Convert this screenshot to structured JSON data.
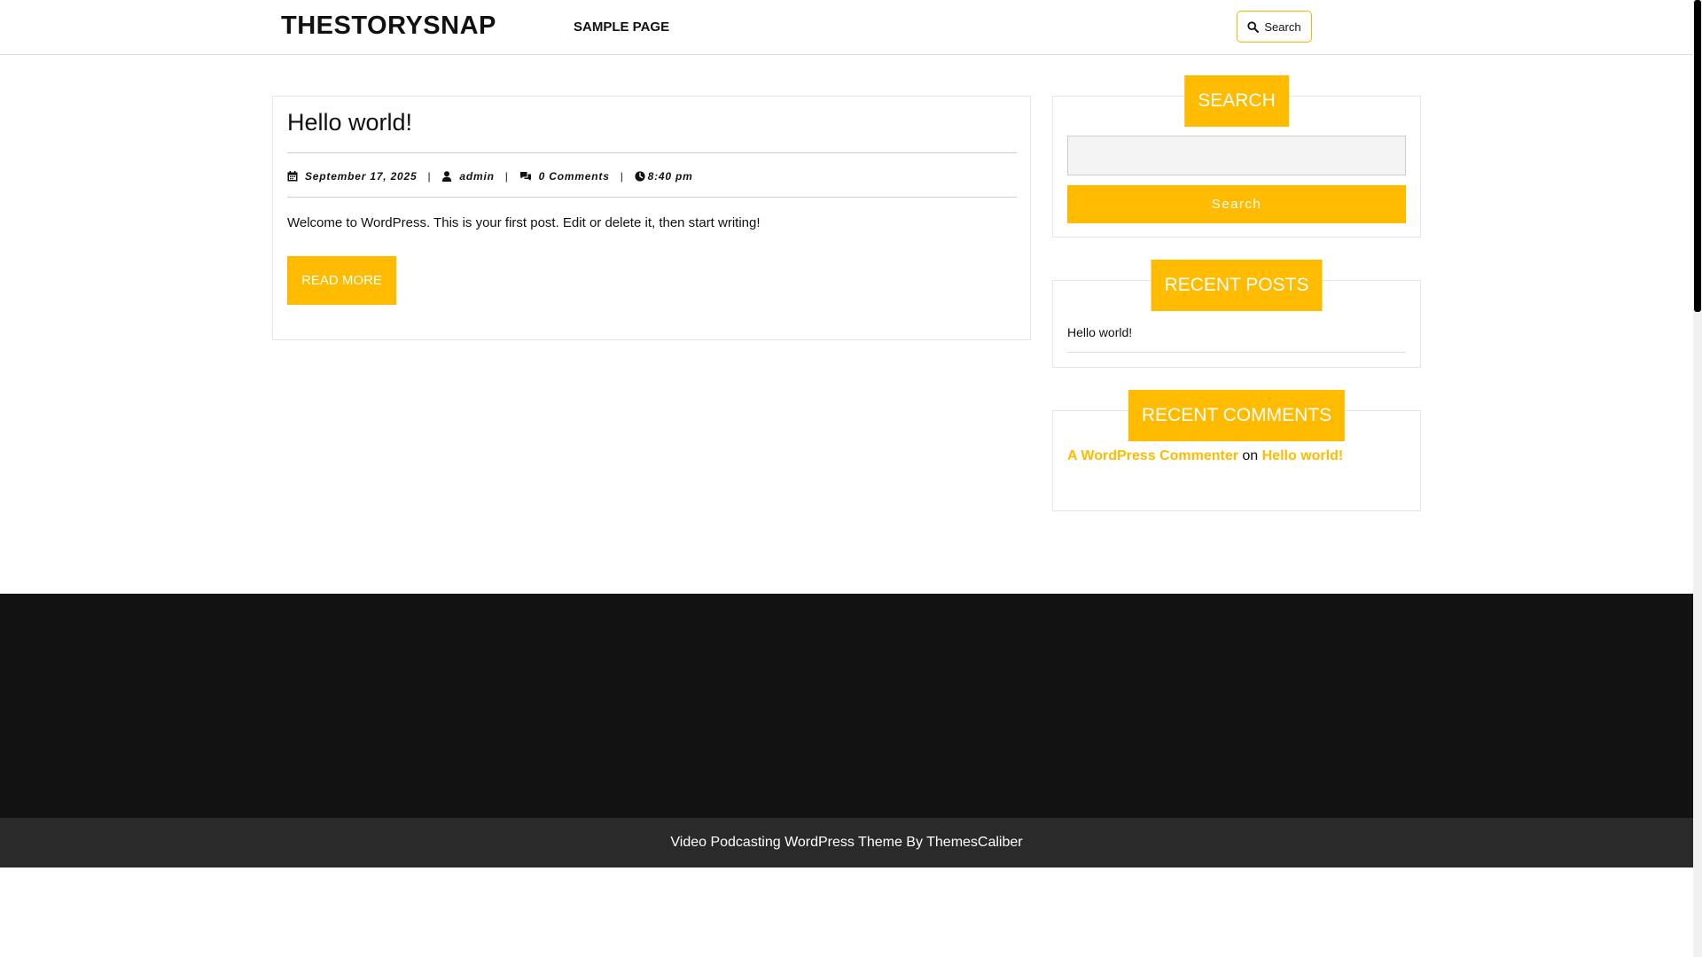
{
  "header": {
    "site_title": "THESTORYSNAP",
    "nav": [
      {
        "label": "SAMPLE PAGE"
      }
    ],
    "search_label": "Search"
  },
  "post": {
    "title": "Hello world!",
    "meta": {
      "date": "September 17, 2025",
      "author": "admin",
      "comments": "0 Comments",
      "time": "8:40 pm",
      "separator": "|"
    },
    "excerpt": "Welcome to WordPress. This is your first post. Edit or delete it, then start writing!",
    "read_more": "READ MORE"
  },
  "sidebar": {
    "search": {
      "title": "SEARCH",
      "input_value": "",
      "button_label": "Search"
    },
    "recent_posts": {
      "title": "RECENT POSTS",
      "items": [
        {
          "label": "Hello world!"
        }
      ]
    },
    "recent_comments": {
      "title": "RECENT COMMENTS",
      "items": [
        {
          "author": "A WordPress Commenter",
          "connector": "on",
          "post": "Hello world!"
        }
      ]
    }
  },
  "footer": {
    "credit": "Video Podcasting WordPress Theme By ThemesCaliber"
  },
  "colors": {
    "accent": "#ffbb00",
    "footer_dark": "#121212",
    "footer_bar": "#2a2a2a"
  },
  "icons": [
    "search-icon",
    "calendar-icon",
    "user-icon",
    "comments-icon",
    "clock-icon"
  ]
}
